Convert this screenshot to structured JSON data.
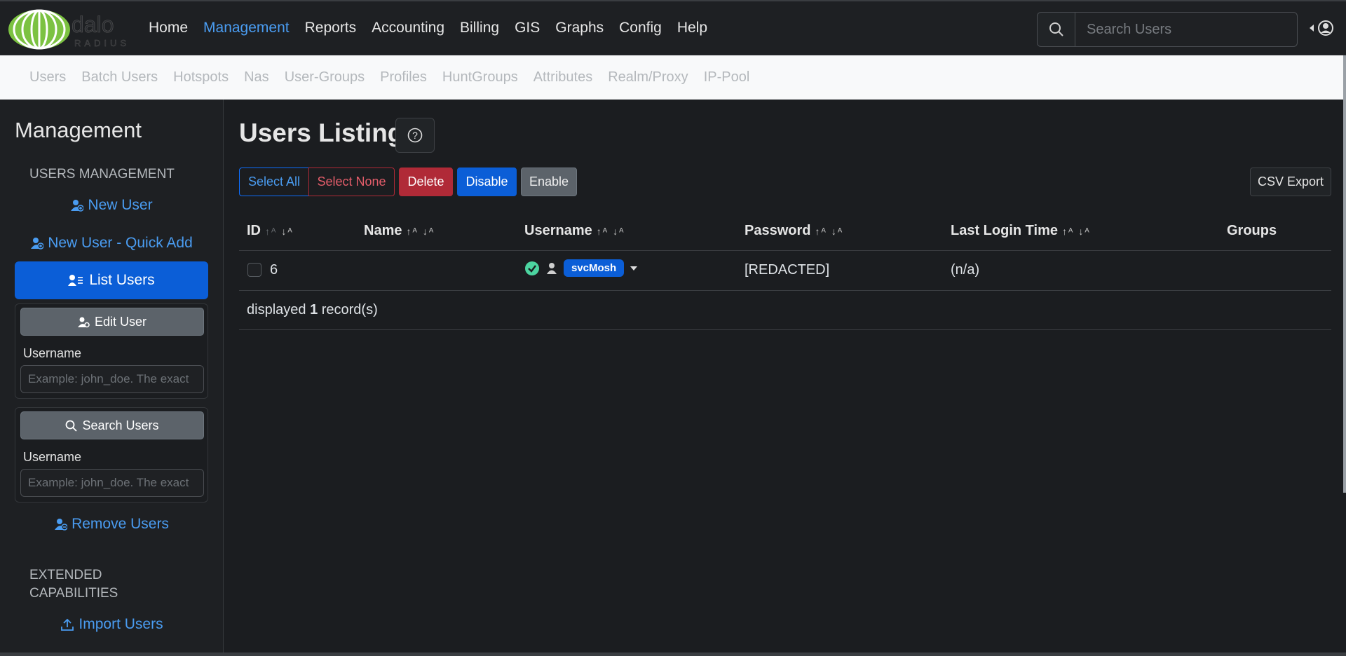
{
  "header": {
    "logo_text": "dalo RADIUS",
    "nav": [
      {
        "label": "Home",
        "active": false
      },
      {
        "label": "Management",
        "active": true
      },
      {
        "label": "Reports",
        "active": false
      },
      {
        "label": "Accounting",
        "active": false
      },
      {
        "label": "Billing",
        "active": false
      },
      {
        "label": "GIS",
        "active": false
      },
      {
        "label": "Graphs",
        "active": false
      },
      {
        "label": "Config",
        "active": false
      },
      {
        "label": "Help",
        "active": false
      }
    ],
    "search_placeholder": "Search Users",
    "accent_color": "#4a9cf1"
  },
  "subnav": [
    "Users",
    "Batch Users",
    "Hotspots",
    "Nas",
    "User-Groups",
    "Profiles",
    "HuntGroups",
    "Attributes",
    "Realm/Proxy",
    "IP-Pool"
  ],
  "sidebar": {
    "title": "Management",
    "section_users": "USERS MANAGEMENT",
    "new_user": "New User",
    "new_user_quick": "New User - Quick Add",
    "list_users": "List Users",
    "edit_user_btn": "Edit User",
    "edit_username_label": "Username",
    "edit_username_placeholder": "Example: john_doe. The exact",
    "search_users_btn": "Search Users",
    "search_username_label": "Username",
    "search_username_placeholder": "Example: john_doe. The exact",
    "remove_users": "Remove Users",
    "section_extended": "EXTENDED CAPABILITIES",
    "import_users": "Import Users"
  },
  "main": {
    "title": "Users Listing",
    "buttons": {
      "select_all": "Select All",
      "select_none": "Select None",
      "delete": "Delete",
      "disable": "Disable",
      "enable": "Enable",
      "csv_export": "CSV Export"
    },
    "columns": {
      "id": "ID",
      "name": "Name",
      "username": "Username",
      "password": "Password",
      "last_login": "Last Login Time",
      "groups": "Groups"
    },
    "rows": [
      {
        "id": "6",
        "name": "",
        "username": "svcMosh",
        "password": "[REDACTED]",
        "last_login": "(n/a)",
        "groups": ""
      }
    ],
    "footer_prefix": "displayed ",
    "footer_count": "1",
    "footer_suffix": " record(s)"
  }
}
